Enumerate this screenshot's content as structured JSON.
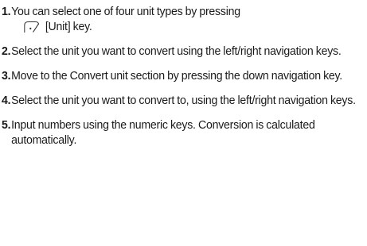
{
  "steps": [
    {
      "number": "1.",
      "text_before_icon": "You can select one of four unit types by pressing",
      "icon": "soft-key-icon",
      "text_after_icon": "[Unit] key."
    },
    {
      "number": "2.",
      "text": "Select the unit you want to convert using the left/right navigation keys."
    },
    {
      "number": "3.",
      "text": "Move to the Convert unit section by pressing the down navigation key."
    },
    {
      "number": "4.",
      "text": "Select the unit you want to convert to, using the left/right navigation keys."
    },
    {
      "number": "5.",
      "text": "Input numbers using the numeric keys. Conversion is calculated automatically."
    }
  ]
}
